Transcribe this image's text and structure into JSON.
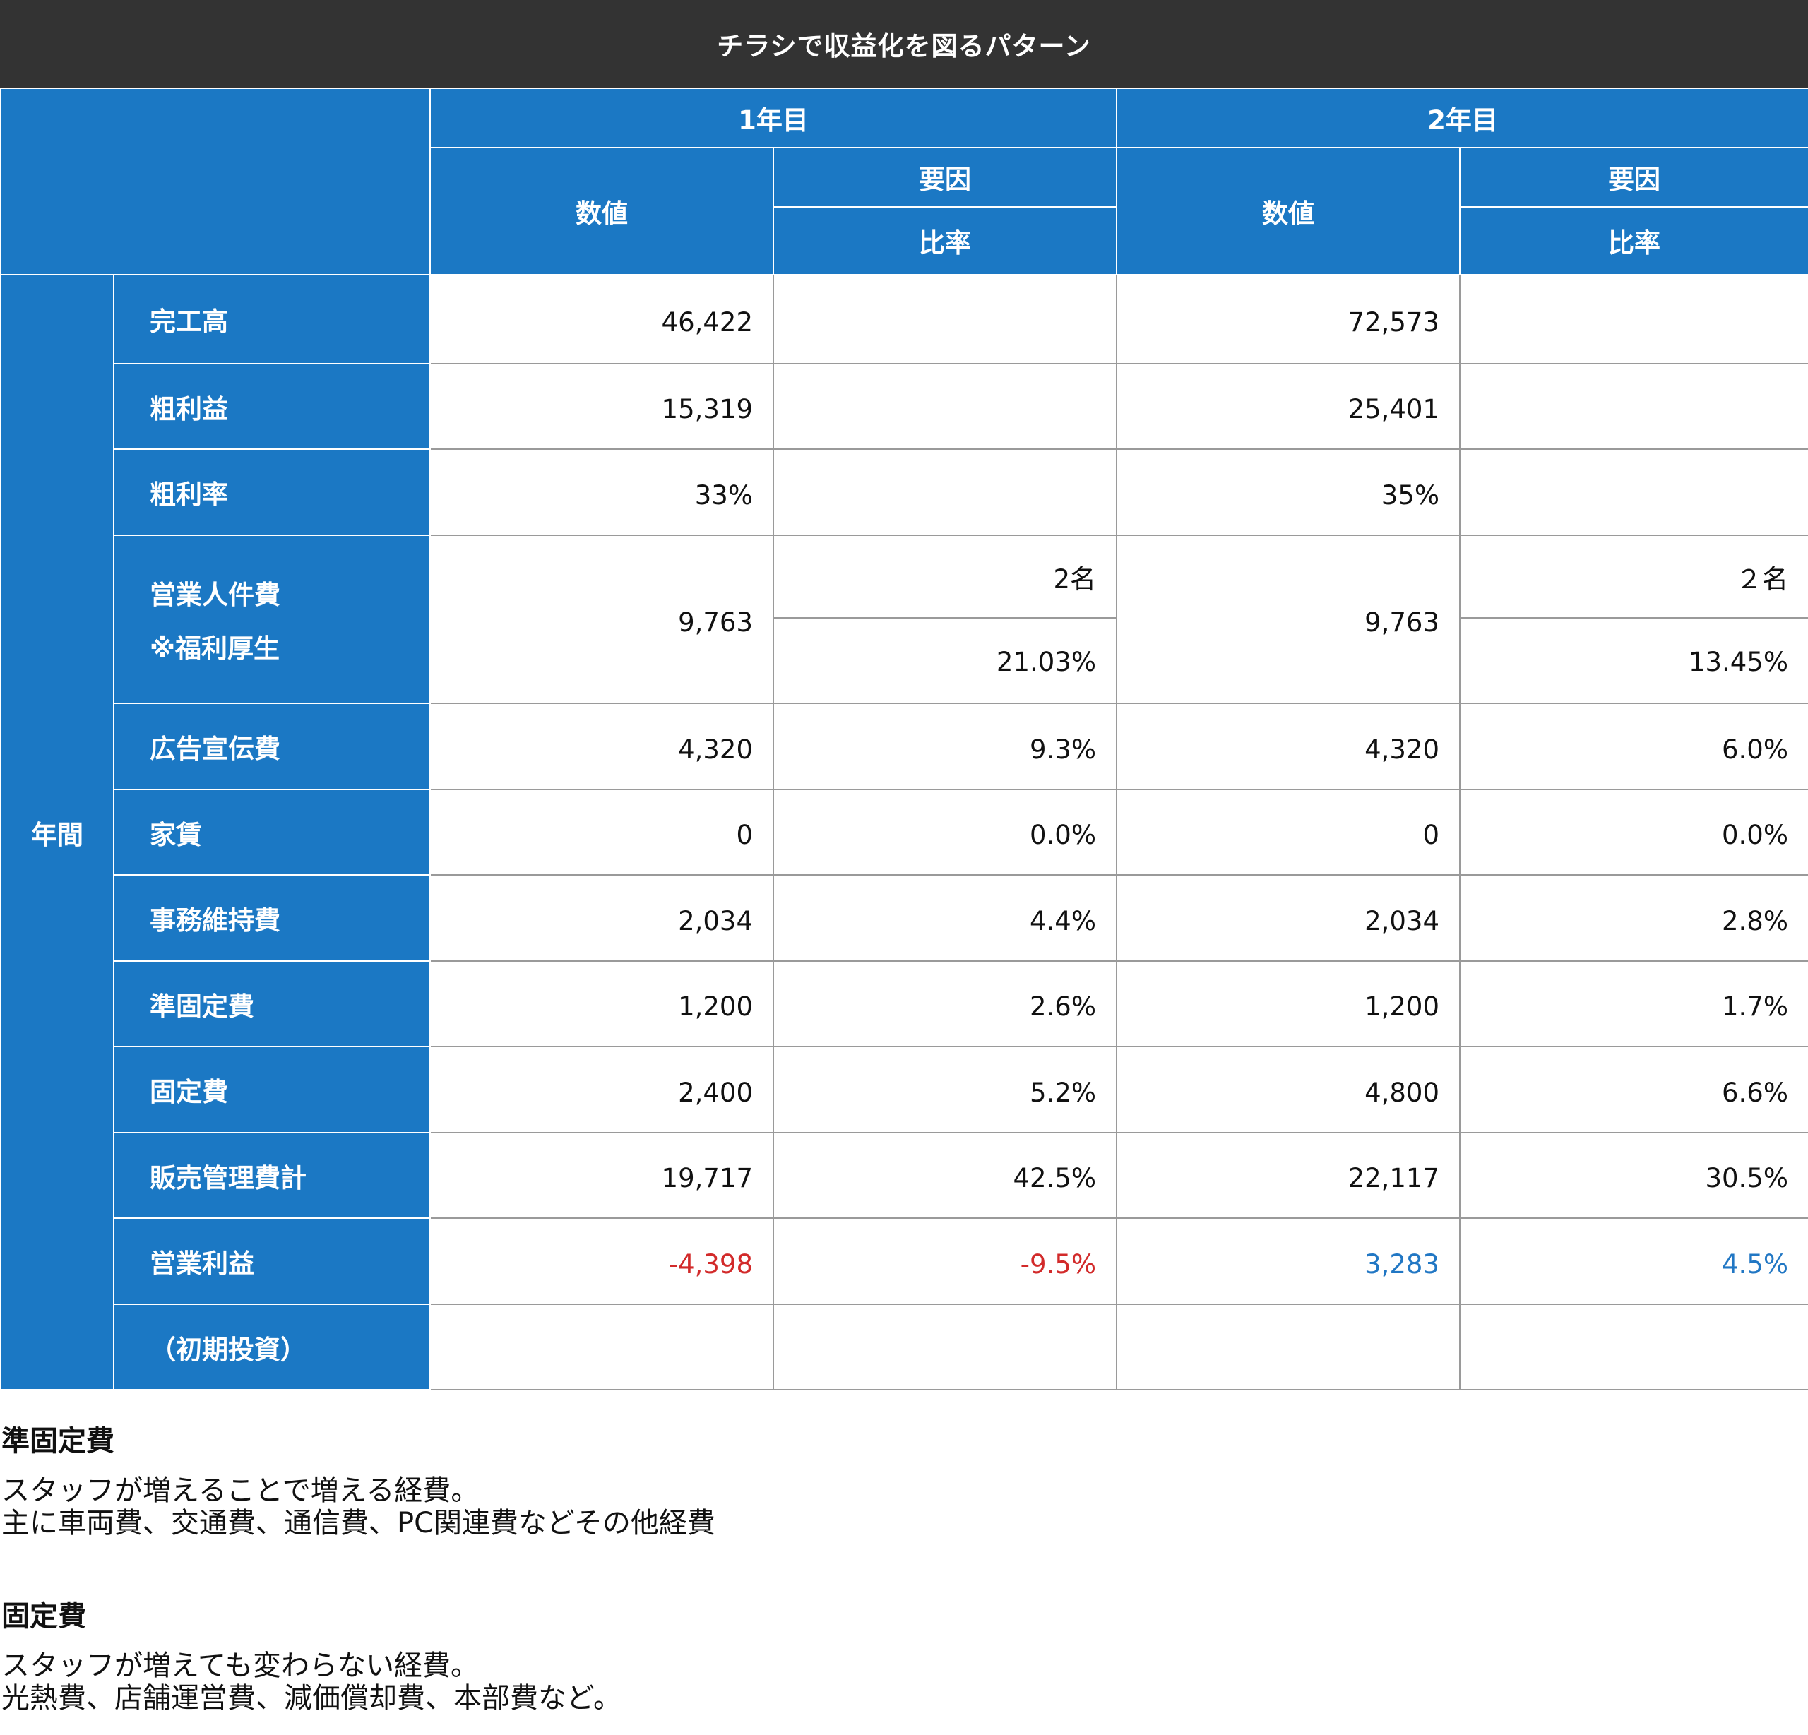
{
  "title": "チラシで収益化を図るパターン",
  "header": {
    "year1": "1年目",
    "year2": "2年目",
    "value": "数値",
    "factor": "要因",
    "ratio": "比率"
  },
  "side_label": "年間",
  "rows": [
    {
      "label": "完工高",
      "y1_value": "46,422",
      "y1_ratio": "",
      "y2_value": "72,573",
      "y2_ratio": ""
    },
    {
      "label": "粗利益",
      "y1_value": "15,319",
      "y1_ratio": "",
      "y2_value": "25,401",
      "y2_ratio": ""
    },
    {
      "label": "粗利率",
      "y1_value": "33%",
      "y1_ratio": "",
      "y2_value": "35%",
      "y2_ratio": ""
    },
    {
      "label": "営業人件費",
      "sublabel": "※福利厚生",
      "y1_value": "9,763",
      "y1_factor": "2名",
      "y1_ratio": "21.03%",
      "y2_value": "9,763",
      "y2_factor": "２名",
      "y2_ratio": "13.45%"
    },
    {
      "label": "広告宣伝費",
      "y1_value": "4,320",
      "y1_ratio": "9.3%",
      "y2_value": "4,320",
      "y2_ratio": "6.0%"
    },
    {
      "label": "家賃",
      "y1_value": "0",
      "y1_ratio": "0.0%",
      "y2_value": "0",
      "y2_ratio": "0.0%"
    },
    {
      "label": "事務維持費",
      "y1_value": "2,034",
      "y1_ratio": "4.4%",
      "y2_value": "2,034",
      "y2_ratio": "2.8%"
    },
    {
      "label": "準固定費",
      "y1_value": "1,200",
      "y1_ratio": "2.6%",
      "y2_value": "1,200",
      "y2_ratio": "1.7%"
    },
    {
      "label": "固定費",
      "y1_value": "2,400",
      "y1_ratio": "5.2%",
      "y2_value": "4,800",
      "y2_ratio": "6.6%"
    },
    {
      "label": "販売管理費計",
      "y1_value": "19,717",
      "y1_ratio": "42.5%",
      "y2_value": "22,117",
      "y2_ratio": "30.5%"
    },
    {
      "label": "営業利益",
      "y1_value": "-4,398",
      "y1_ratio": "-9.5%",
      "y2_value": "3,283",
      "y2_ratio": "4.5%"
    },
    {
      "label": "（初期投資）",
      "y1_value": "",
      "y1_ratio": "",
      "y2_value": "",
      "y2_ratio": ""
    }
  ],
  "colors": {
    "title_bg": "#333333",
    "header_bg": "#1b78c4",
    "negative": "#d22a2a",
    "positive": "#2177c4"
  },
  "notes": [
    {
      "heading": "準固定費",
      "lines": [
        "スタッフが増えることで増える経費。",
        "主に車両費、交通費、通信費、PC関連費などその他経費"
      ]
    },
    {
      "heading": "固定費",
      "lines": [
        "スタッフが増えても変わらない経費。",
        "光熱費、店舗運営費、減価償却費、本部費など。"
      ]
    }
  ]
}
